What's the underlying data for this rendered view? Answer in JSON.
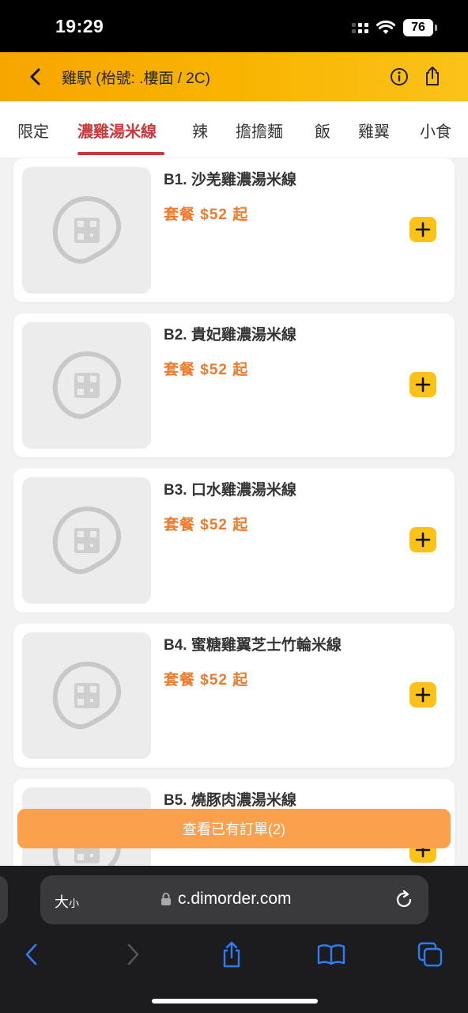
{
  "status_bar": {
    "time": "19:29",
    "battery": "76"
  },
  "header": {
    "title": "雞駅 (枱號: .樓面 / 2C)"
  },
  "tabs": [
    {
      "label": "限定"
    },
    {
      "label": "濃雞湯米線"
    },
    {
      "label": "辣"
    },
    {
      "label": "擔擔麵"
    },
    {
      "label": "飯"
    },
    {
      "label": "雞翼"
    },
    {
      "label": "小食"
    }
  ],
  "menu": {
    "items": [
      {
        "name": "B1. 沙羌雞濃湯米線",
        "price": "套餐 $52 起"
      },
      {
        "name": "B2. 貴妃雞濃湯米線",
        "price": "套餐 $52 起"
      },
      {
        "name": "B3. 口水雞濃湯米線",
        "price": "套餐 $52 起"
      },
      {
        "name": "B4. 蜜糖雞翼芝士竹輪米線",
        "price": "套餐 $52 起"
      },
      {
        "name": "B5. 燒豚肉濃湯米線",
        "price": ""
      }
    ]
  },
  "order_bar": {
    "label": "查看已有訂單(2)"
  },
  "browser": {
    "text_size": "大",
    "text_size_small": "小",
    "url": "c.dimorder.com"
  },
  "colors": {
    "accent": "#f9b400",
    "active_tab": "#c8393d",
    "price": "#ef7a2c",
    "add_button": "#fbc21a",
    "order_bar": "#fba04d"
  }
}
